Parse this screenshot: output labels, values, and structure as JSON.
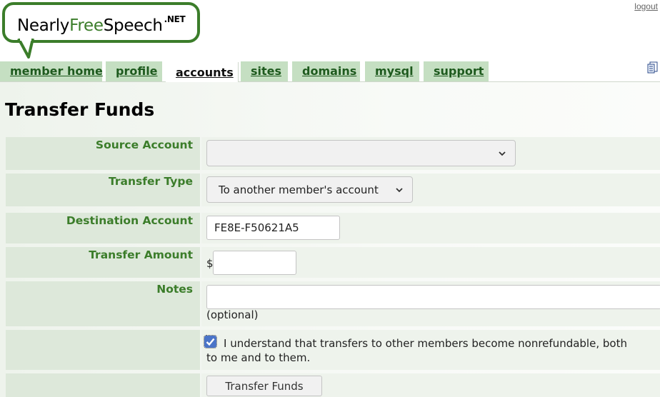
{
  "header": {
    "logo_text_1": "Nearly",
    "logo_text_2": "Free",
    "logo_text_3": "Speech",
    "logo_suffix": ".NET",
    "logout_label": "logout"
  },
  "tabs": [
    {
      "label": "member home"
    },
    {
      "label": "profile"
    },
    {
      "label": "accounts",
      "active": true
    },
    {
      "label": "sites"
    },
    {
      "label": "domains"
    },
    {
      "label": "mysql"
    },
    {
      "label": "support"
    }
  ],
  "page": {
    "title": "Transfer Funds"
  },
  "form": {
    "source_account": {
      "label": "Source Account",
      "value": ""
    },
    "transfer_type": {
      "label": "Transfer Type",
      "value": "To another member's account"
    },
    "destination_account": {
      "label": "Destination Account",
      "value": "FE8E-F50621A5"
    },
    "transfer_amount": {
      "label": "Transfer Amount",
      "currency": "$",
      "value": ""
    },
    "notes": {
      "label": "Notes",
      "value": "",
      "hint": "(optional)"
    },
    "acknowledge": {
      "checked": true,
      "text": "I understand that transfers to other members become nonrefundable, both to me and to them."
    },
    "submit_label": "Transfer Funds"
  },
  "colors": {
    "brand_green": "#3b7d2a",
    "tab_bg": "#c5dfc2",
    "label_bg": "#dde8da",
    "checkbox": "#4a74c8"
  },
  "icons": {
    "chevron": "chevron-down-icon",
    "doc": "document-icon",
    "check": "checkmark-icon"
  }
}
